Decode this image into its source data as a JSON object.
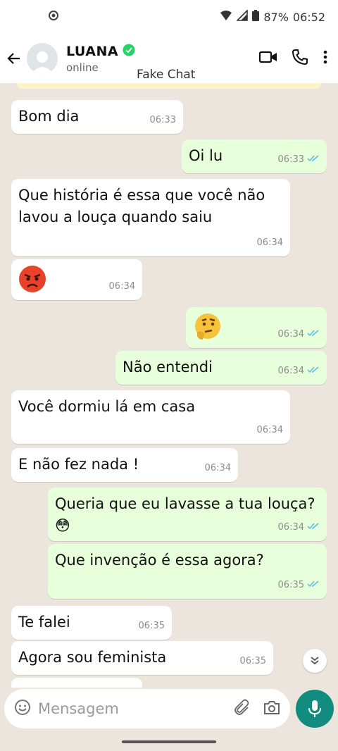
{
  "statusbar": {
    "battery": "87%",
    "time": "06:52"
  },
  "header": {
    "name": "LUANA",
    "status": "online"
  },
  "watermark": "Fake Chat",
  "messages": [
    {
      "dir": "in",
      "text": "Bom dia",
      "time": "06:33"
    },
    {
      "dir": "out",
      "text": "Oi lu",
      "time": "06:33",
      "read": true
    },
    {
      "dir": "in",
      "text": "Que história é essa que você não lavou a louça quando saiu",
      "time": "06:34"
    },
    {
      "dir": "in",
      "emoji": "angry-face",
      "time": "06:34"
    },
    {
      "dir": "out",
      "emoji": "thinking-face",
      "time": "06:34",
      "read": true
    },
    {
      "dir": "out",
      "text": "Não entendi",
      "time": "06:34",
      "read": true
    },
    {
      "dir": "in",
      "text": "Você dormiu lá em casa",
      "time": "06:34"
    },
    {
      "dir": "in",
      "text": "E não fez nada !",
      "time": "06:34"
    },
    {
      "dir": "out",
      "text": "Queria que eu lavasse a tua louça?😳",
      "time": "06:34",
      "read": true
    },
    {
      "dir": "out",
      "text": "Que invenção é essa agora?",
      "time": "06:35",
      "read": true
    },
    {
      "dir": "in",
      "text": "Te falei",
      "time": "06:35"
    },
    {
      "dir": "in",
      "text": "Agora sou feminista",
      "time": "06:35"
    }
  ],
  "composer": {
    "placeholder": "Mensagem"
  },
  "colors": {
    "accent": "#128c7e",
    "outgoing": "#e7ffdb",
    "read_ticks": "#53bdeb",
    "verified": "#25d366"
  }
}
